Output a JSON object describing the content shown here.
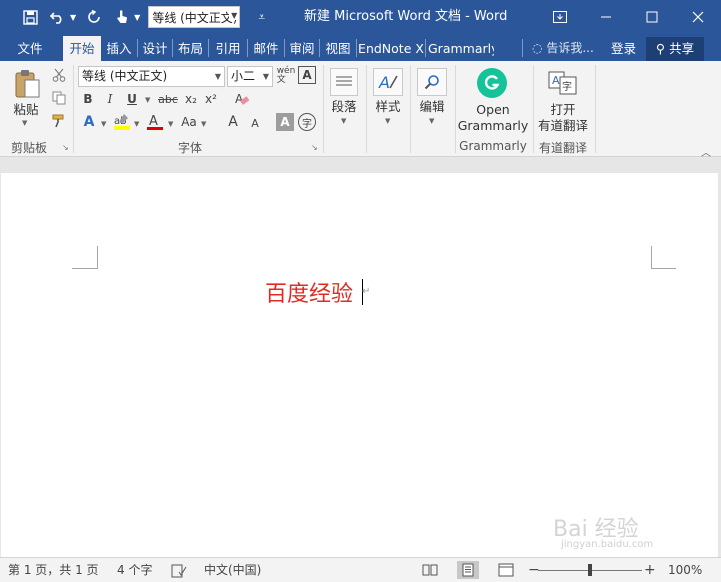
{
  "titlebar": {
    "title": "新建 Microsoft Word 文档 - Word",
    "font_combo": "等线 (中文正文)"
  },
  "tabs": [
    {
      "label": "文件"
    },
    {
      "label": "开始"
    },
    {
      "label": "插入"
    },
    {
      "label": "设计"
    },
    {
      "label": "布局"
    },
    {
      "label": "引用"
    },
    {
      "label": "邮件"
    },
    {
      "label": "审阅"
    },
    {
      "label": "视图"
    },
    {
      "label": "EndNote X"
    },
    {
      "label": "Grammarly"
    }
  ],
  "tellme": "告诉我...",
  "signin": "登录",
  "share": "共享",
  "ribbon": {
    "clipboard": {
      "paste": "粘贴",
      "label": "剪贴板"
    },
    "font": {
      "name": "等线 (中文正文)",
      "size": "小二",
      "label": "字体",
      "bold": "B",
      "italic": "I",
      "underline": "U",
      "strike": "abc",
      "subscript": "x₂",
      "superscript": "x²",
      "grow": "A",
      "shrink": "A",
      "case": "Aa"
    },
    "paragraph": {
      "label": "段落"
    },
    "styles": {
      "label": "样式"
    },
    "editing": {
      "label": "编辑"
    },
    "grammarly": {
      "line1": "Open",
      "line2": "Grammarly",
      "label": "Grammarly"
    },
    "translate": {
      "line1": "打开",
      "line2": "有道翻译",
      "label": "有道翻译"
    }
  },
  "document": {
    "text": "百度经验",
    "paragraph_mark": "↵",
    "watermark": "Bai 经验",
    "watermark_sub": "jingyan.baidu.com"
  },
  "statusbar": {
    "page": "第 1 页，共 1 页",
    "words": "4 个字",
    "language": "中文(中国)",
    "zoom_minus": "−",
    "zoom_plus": "+",
    "zoom": "100%"
  },
  "colors": {
    "accent": "#2b579a",
    "doc_text": "#e12b22",
    "grammarly": "#15c39a"
  }
}
